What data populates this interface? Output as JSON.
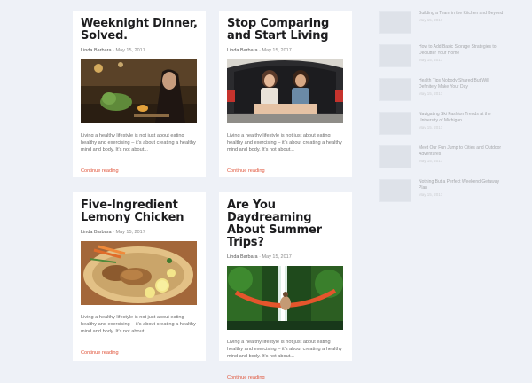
{
  "posts": [
    {
      "title": "Weeknight Dinner, Solved.",
      "author": "Linda Barbara",
      "date": "May 15, 2017",
      "excerpt": "Living a healthy lifestyle is not just about eating healthy and exercising – it's about creating a healthy mind and body. It's not about...",
      "more": "Continue reading"
    },
    {
      "title": "Stop Comparing and Start Living",
      "author": "Linda Barbara",
      "date": "May 15, 2017",
      "excerpt": "Living a healthy lifestyle is not just about eating healthy and exercising – it's about creating a healthy mind and body. It's not about...",
      "more": "Continue reading"
    },
    {
      "title": "Five-Ingredient Lemony Chicken",
      "author": "Linda Barbara",
      "date": "May 15, 2017",
      "excerpt": "Living a healthy lifestyle is not just about eating healthy and exercising – it's about creating a healthy mind and body. It's not about...",
      "more": "Continue reading"
    },
    {
      "title": "Are You Daydreaming About Summer Trips?",
      "author": "Linda Barbara",
      "date": "May 15, 2017",
      "excerpt": "Living a healthy lifestyle is not just about eating healthy and exercising – it's about creating a healthy mind and body. It's not about...",
      "more": "Continue reading"
    }
  ],
  "meta_separator": "·",
  "sidebar": {
    "items": [
      {
        "title": "Building a Team in the Kitchen and Beyond",
        "date": "May 15, 2017"
      },
      {
        "title": "How to Add Basic Storage Strategies to Declutter Your Home",
        "date": "May 15, 2017"
      },
      {
        "title": "Health Tips Nobody Shared But Will Definitely Make Your Day",
        "date": "May 15, 2017"
      },
      {
        "title": "Navigating Ski Fashion Trends at the University of Michigan",
        "date": "May 15, 2017"
      },
      {
        "title": "Meet Our Fun Jump to Cities and Outdoor Adventures",
        "date": "May 15, 2017"
      },
      {
        "title": "Nothing But a Perfect Weekend Getaway Plan",
        "date": "May 15, 2017"
      }
    ]
  },
  "colors": {
    "accent": "#e0553b",
    "background": "#eef1f7",
    "card": "#ffffff"
  }
}
